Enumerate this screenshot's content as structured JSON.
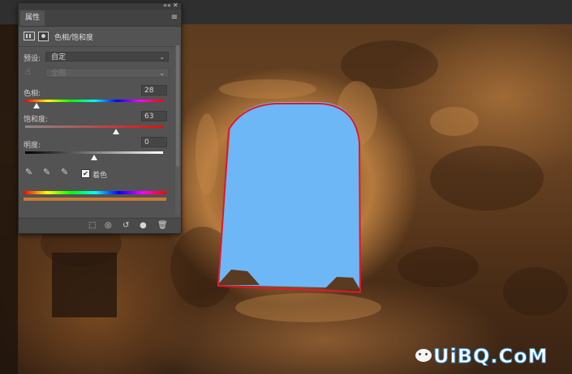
{
  "panel": {
    "chrome": {
      "collapse_glyph": "««",
      "close_glyph": "✕"
    },
    "tab_label": "属性",
    "menu_icon": "hamburger-icon",
    "adjustment_title": "色相/饱和度",
    "preset": {
      "label": "预设:",
      "value": "自定"
    },
    "channel": {
      "value": "全图"
    },
    "hue": {
      "label": "色相:",
      "value": "28",
      "level": 0.08
    },
    "saturation": {
      "label": "饱和度:",
      "value": "63",
      "level": 0.66
    },
    "lightness": {
      "label": "明度:",
      "value": "0",
      "level": 0.5
    },
    "colorize": {
      "label": "着色",
      "checked": true,
      "check_glyph": "✔"
    },
    "tint_color": "#c87b34",
    "bottom_icons": [
      "clip-to-layer-icon",
      "view-previous-icon",
      "reset-icon",
      "visibility-icon",
      "delete-icon"
    ]
  },
  "watermark": {
    "text": "UiBQ.CoM"
  }
}
